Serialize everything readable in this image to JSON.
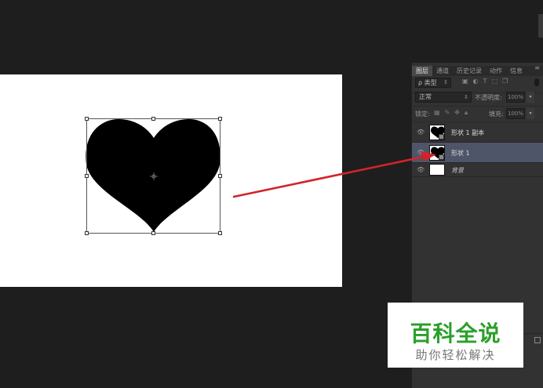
{
  "canvas": {
    "background": "#ffffff",
    "shape_color": "#000000"
  },
  "annotation": {
    "arrow_color": "#d2232a"
  },
  "layers_panel": {
    "tabs": [
      "图层",
      "通道",
      "历史记录",
      "动作",
      "信息"
    ],
    "active_tab": "图层",
    "filter_kind": "ρ 类型",
    "blend_mode": "正常",
    "opacity_label": "不透明度:",
    "opacity_value": "100%",
    "lock_label": "锁定:",
    "fill_label": "填充:",
    "fill_value": "100%",
    "layers": [
      {
        "name": "形状 1 副本",
        "selected": false,
        "icon": "heart-shape-thumbnail"
      },
      {
        "name": "形状 1",
        "selected": true,
        "icon": "heart-shape-thumbnail"
      },
      {
        "name": "背景",
        "selected": false,
        "icon": "white-thumbnail"
      }
    ],
    "selected_color": "#4f5568"
  },
  "watermark": {
    "title": "百科全说",
    "subtitle": "助你轻松解决",
    "title_color": "#2aa02a"
  }
}
